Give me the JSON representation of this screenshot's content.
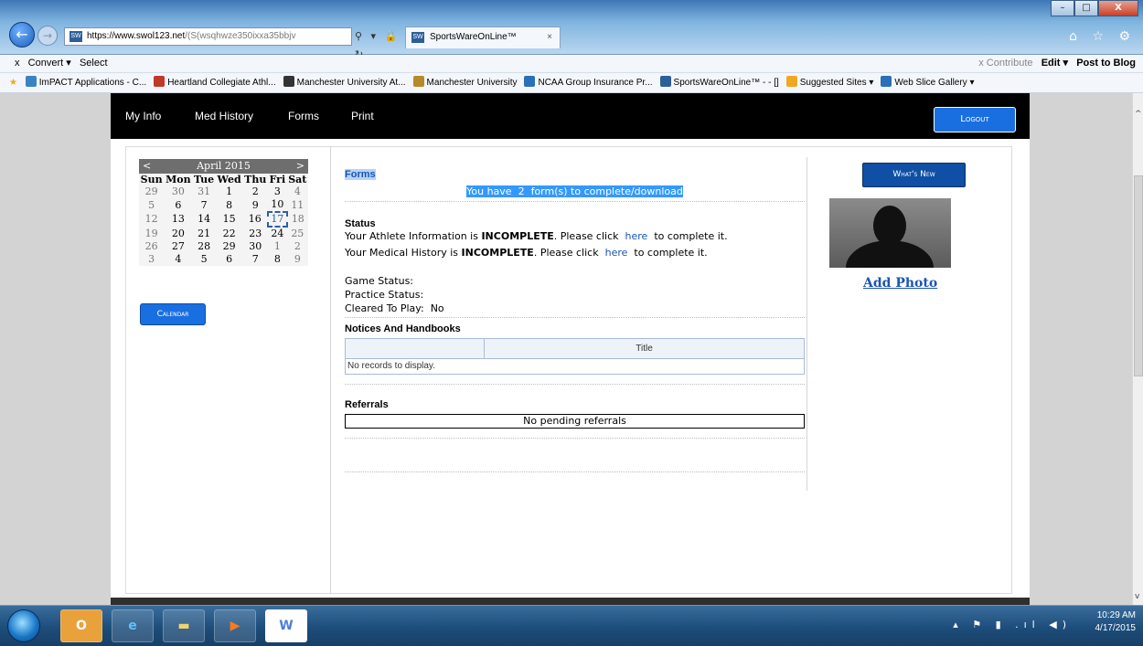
{
  "browser": {
    "url_domain": "https://www.swol123.net",
    "url_rest": "/(S(wsqhwze350ixxa35bbjv",
    "tab_title": "SportsWareOnLine™",
    "tab_close": "×",
    "addr_buttons": "⚲ ▾ 🔒 ↻",
    "win_min": "–",
    "win_max": "□",
    "win_close": "X",
    "right_icons": "⌂ ☆ ⚙"
  },
  "command_bar": {
    "close": "x",
    "convert": "Convert ▾",
    "select": "Select",
    "contribute": "x Contribute",
    "edit": "Edit ▾",
    "post_to_blog": "Post to Blog"
  },
  "favorites": [
    {
      "label": "ImPACT Applications - C...",
      "color": "#3b82c4"
    },
    {
      "label": "Heartland Collegiate Athl...",
      "color": "#c0392b"
    },
    {
      "label": "Manchester University At...",
      "color": "#333333"
    },
    {
      "label": "Manchester University",
      "color": "#b58a2a"
    },
    {
      "label": "NCAA Group Insurance Pr...",
      "color": "#2a6fb8"
    },
    {
      "label": "SportsWareOnLine™ - - []",
      "color": "#2d5e9a"
    },
    {
      "label": "Suggested Sites ▾",
      "color": "#f0a81f"
    },
    {
      "label": "Web Slice Gallery ▾",
      "color": "#2a6fb8"
    }
  ],
  "nav": {
    "my_info": "My Info",
    "med_history": "Med History",
    "forms": "Forms",
    "print": "Print",
    "logout": "Logout"
  },
  "calendar": {
    "prev": "<",
    "next": ">",
    "month": "April 2015",
    "weekdays": [
      "Sun",
      "Mon",
      "Tue",
      "Wed",
      "Thu",
      "Fri",
      "Sat"
    ],
    "weeks": [
      [
        [
          "29",
          true
        ],
        [
          "30",
          true
        ],
        [
          "31",
          true
        ],
        [
          "1",
          false
        ],
        [
          "2",
          false
        ],
        [
          "3",
          false
        ],
        [
          "4",
          true
        ]
      ],
      [
        [
          "5",
          true
        ],
        [
          "6",
          false
        ],
        [
          "7",
          false
        ],
        [
          "8",
          false
        ],
        [
          "9",
          false
        ],
        [
          "10",
          false
        ],
        [
          "11",
          true
        ]
      ],
      [
        [
          "12",
          true
        ],
        [
          "13",
          false
        ],
        [
          "14",
          false
        ],
        [
          "15",
          false
        ],
        [
          "16",
          false
        ],
        [
          "17",
          false
        ],
        [
          "18",
          true
        ]
      ],
      [
        [
          "19",
          true
        ],
        [
          "20",
          false
        ],
        [
          "21",
          false
        ],
        [
          "22",
          false
        ],
        [
          "23",
          false
        ],
        [
          "24",
          false
        ],
        [
          "25",
          true
        ]
      ],
      [
        [
          "26",
          true
        ],
        [
          "27",
          false
        ],
        [
          "28",
          false
        ],
        [
          "29",
          false
        ],
        [
          "30",
          false
        ],
        [
          "1",
          true
        ],
        [
          "2",
          true
        ]
      ],
      [
        [
          "3",
          true
        ],
        [
          "4",
          false
        ],
        [
          "5",
          false
        ],
        [
          "6",
          false
        ],
        [
          "7",
          false
        ],
        [
          "8",
          false
        ],
        [
          "9",
          true
        ]
      ]
    ],
    "selected": "17",
    "button": "Calendar"
  },
  "forms": {
    "heading": "Forms",
    "banner_prefix": "You have",
    "count": "2",
    "banner_suffix": "form(s) to complete/download"
  },
  "status": {
    "heading": "Status",
    "athlete_prefix": "Your Athlete Information is",
    "athlete_state": "INCOMPLETE",
    "click": ". Please click",
    "here": "here",
    "suffix": "to complete it.",
    "medical_prefix": "Your Medical History is",
    "medical_state": "INCOMPLETE",
    "game_status": "Game Status:",
    "practice_status": "Practice Status:",
    "cleared_label": "Cleared To Play:",
    "cleared_value": "No"
  },
  "notices": {
    "heading": "Notices And Handbooks",
    "column_title": "Title",
    "empty": "No records to display."
  },
  "referrals": {
    "heading": "Referrals",
    "empty": "No pending referrals"
  },
  "sidebar": {
    "whats_new": "What's New",
    "add_photo": "Add Photo"
  },
  "taskbar": {
    "time": "10:29 AM",
    "date": "4/17/2015",
    "tray": "▴ ⚑ ▮ .ıl ◀)"
  }
}
